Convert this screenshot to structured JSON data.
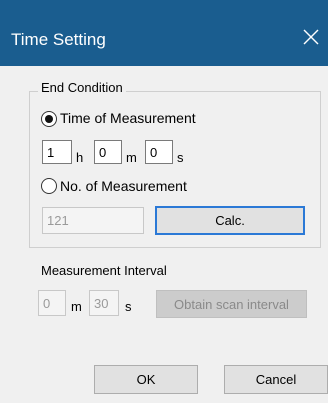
{
  "window": {
    "title": "Time Setting"
  },
  "end_condition": {
    "legend": "End Condition",
    "time_of_measurement": {
      "label": "Time of Measurement",
      "selected": true,
      "hours": "1",
      "hours_unit": "h",
      "minutes": "0",
      "minutes_unit": "m",
      "seconds": "0",
      "seconds_unit": "s"
    },
    "no_of_measurement": {
      "label": "No. of Measurement",
      "selected": false,
      "value": "121",
      "calc_label": "Calc."
    }
  },
  "measurement_interval": {
    "label": "Measurement Interval",
    "minutes": "0",
    "minutes_unit": "m",
    "seconds": "30",
    "seconds_unit": "s",
    "obtain_label": "Obtain scan interval"
  },
  "buttons": {
    "ok": "OK",
    "cancel": "Cancel"
  }
}
